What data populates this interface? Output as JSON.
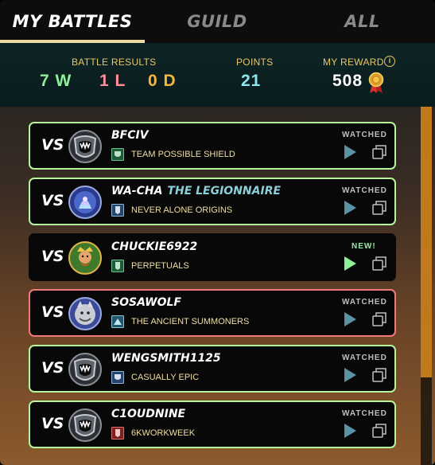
{
  "tabs": [
    {
      "label": "MY BATTLES",
      "active": true
    },
    {
      "label": "GUILD",
      "active": false
    },
    {
      "label": "ALL",
      "active": false
    }
  ],
  "stats": {
    "battle_results_label": "BATTLE RESULTS",
    "wins": "7 W",
    "losses": "1 L",
    "draws": "0 D",
    "points_label": "POINTS",
    "points": "21",
    "reward_label": "MY REWARD",
    "reward": "508"
  },
  "colors": {
    "win_border": "#b7f59b",
    "loss_border": "#f07a7a",
    "accent_gold": "#e8c76a",
    "play_watched": "#5b93a6",
    "play_new": "#8ff09a"
  },
  "battles": [
    {
      "vs": "VS",
      "name": "BFCIV",
      "title": "",
      "guild": "TEAM POSSIBLE SHIELD",
      "status": "WATCHED",
      "result": "win",
      "avatar": "fanged-shield-avatar",
      "guild_icon": "green-crest-icon"
    },
    {
      "vs": "VS",
      "name": "WA-CHA",
      "title": "THE LEGIONNAIRE",
      "guild": "NEVER ALONE ORIGINS",
      "status": "WATCHED",
      "result": "win",
      "avatar": "spirit-mage-avatar",
      "guild_icon": "blue-crest-icon"
    },
    {
      "vs": "VS",
      "name": "CHUCKIE6922",
      "title": "",
      "guild": "PERPETUALS",
      "status": "NEW!",
      "result": "new",
      "avatar": "bearded-king-avatar",
      "guild_icon": "green-crest-icon"
    },
    {
      "vs": "VS",
      "name": "SOSAWOLF",
      "title": "",
      "guild": "THE ANCIENT SUMMONERS",
      "status": "WATCHED",
      "result": "loss",
      "avatar": "grey-beast-avatar",
      "guild_icon": "cyan-crest-icon"
    },
    {
      "vs": "VS",
      "name": "WENGSMITH1125",
      "title": "",
      "guild": "CASUALLY EPIC",
      "status": "WATCHED",
      "result": "win",
      "avatar": "fanged-shield-avatar",
      "guild_icon": "blue-crest-icon"
    },
    {
      "vs": "VS",
      "name": "C1OUDNINE",
      "title": "",
      "guild": "6KWORKWEEK",
      "status": "WATCHED",
      "result": "win",
      "avatar": "fanged-shield-avatar",
      "guild_icon": "red-crest-icon"
    }
  ]
}
